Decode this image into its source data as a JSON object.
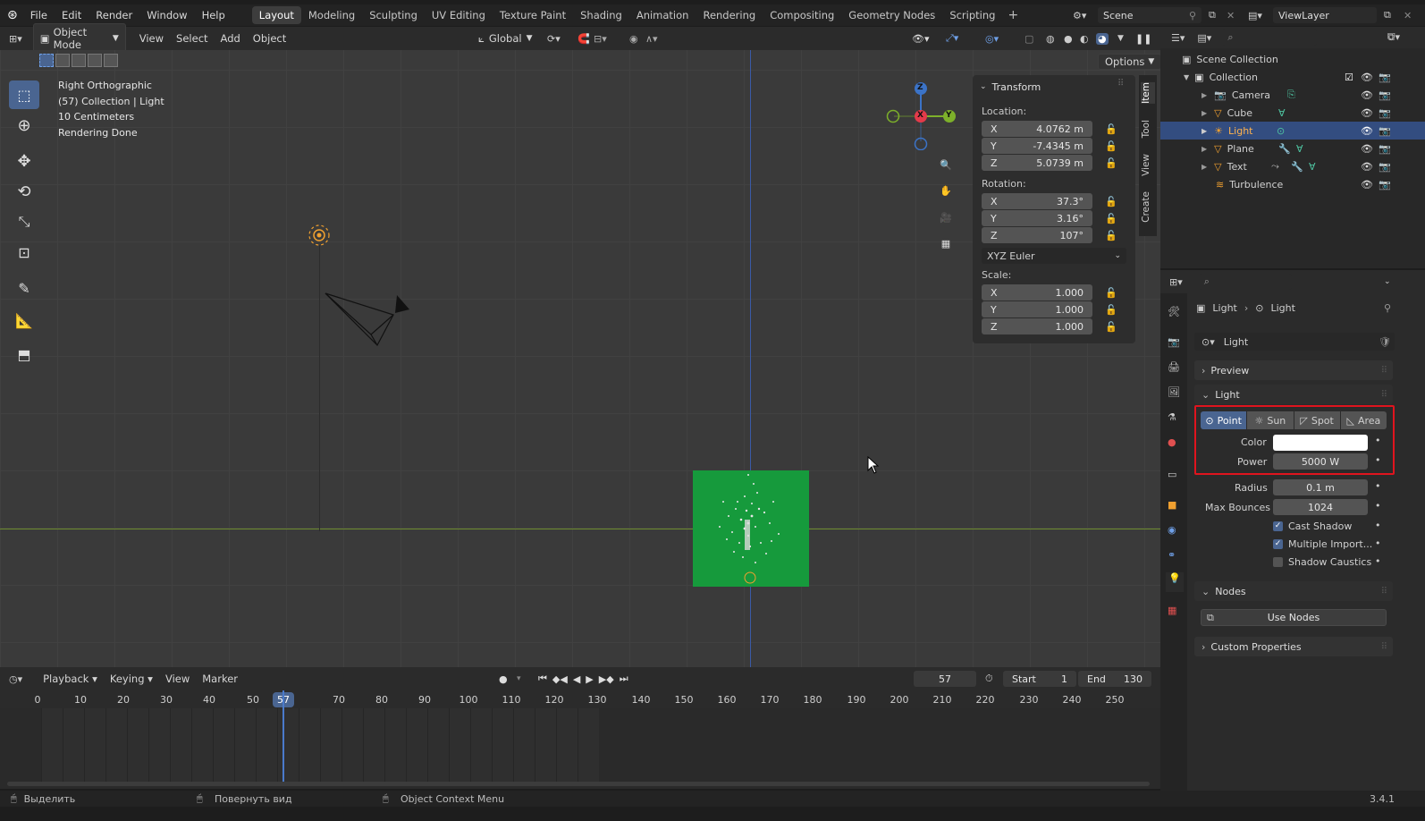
{
  "menu": [
    "File",
    "Edit",
    "Render",
    "Window",
    "Help"
  ],
  "workspaces": [
    "Layout",
    "Modeling",
    "Sculpting",
    "UV Editing",
    "Texture Paint",
    "Shading",
    "Animation",
    "Rendering",
    "Compositing",
    "Geometry Nodes",
    "Scripting"
  ],
  "active_workspace": "Layout",
  "scene": {
    "label": "Scene",
    "view_layer": "ViewLayer"
  },
  "viewport_header": {
    "mode": "Object Mode",
    "items": [
      "View",
      "Select",
      "Add",
      "Object"
    ],
    "orientation": "Global",
    "options": "Options"
  },
  "overlay_text": [
    "Right Orthographic",
    "(57) Collection | Light",
    "10 Centimeters",
    "Rendering Done"
  ],
  "gizmo": {
    "z": "Z",
    "x": "X",
    "y": "Y"
  },
  "transform": {
    "title": "Transform",
    "location_label": "Location:",
    "location": [
      {
        "axis": "X",
        "value": "4.0762 m"
      },
      {
        "axis": "Y",
        "value": "-7.4345 m"
      },
      {
        "axis": "Z",
        "value": "5.0739 m"
      }
    ],
    "rotation_label": "Rotation:",
    "rotation": [
      {
        "axis": "X",
        "value": "37.3°"
      },
      {
        "axis": "Y",
        "value": "3.16°"
      },
      {
        "axis": "Z",
        "value": "107°"
      }
    ],
    "rotation_mode": "XYZ Euler",
    "scale_label": "Scale:",
    "scale": [
      {
        "axis": "X",
        "value": "1.000"
      },
      {
        "axis": "Y",
        "value": "1.000"
      },
      {
        "axis": "Z",
        "value": "1.000"
      }
    ]
  },
  "side_tabs": [
    "Item",
    "Tool",
    "View",
    "Create"
  ],
  "outliner": {
    "scene_collection": "Scene Collection",
    "collection": "Collection",
    "items": [
      {
        "name": "Camera",
        "selected": false
      },
      {
        "name": "Cube",
        "selected": false
      },
      {
        "name": "Light",
        "selected": true
      },
      {
        "name": "Plane",
        "selected": false
      },
      {
        "name": "Text",
        "selected": false
      },
      {
        "name": "Turbulence",
        "selected": false
      }
    ]
  },
  "properties": {
    "breadcrumb": [
      "Light",
      "Light"
    ],
    "datablock": "Light",
    "panels": {
      "preview": "Preview",
      "light": "Light",
      "nodes": "Nodes",
      "custom": "Custom Properties"
    },
    "light_types": [
      "Point",
      "Sun",
      "Spot",
      "Area"
    ],
    "active_light_type": "Point",
    "color_label": "Color",
    "power_label": "Power",
    "power": "5000 W",
    "radius_label": "Radius",
    "radius": "0.1 m",
    "max_bounces_label": "Max Bounces",
    "max_bounces": "1024",
    "cast_shadow": "Cast Shadow",
    "multiple_importance": "Multiple Import...",
    "shadow_caustics": "Shadow Caustics",
    "use_nodes": "Use Nodes"
  },
  "timeline": {
    "menus": [
      "Playback",
      "Keying",
      "View",
      "Marker"
    ],
    "current_frame": "57",
    "start_label": "Start",
    "start": "1",
    "end_label": "End",
    "end": "130",
    "ticks": [
      "0",
      "10",
      "20",
      "30",
      "40",
      "50",
      "70",
      "80",
      "90",
      "100",
      "110",
      "120",
      "130",
      "140",
      "150",
      "160",
      "170",
      "180",
      "190",
      "200",
      "210",
      "220",
      "230",
      "240",
      "250"
    ]
  },
  "statusbar": {
    "select": "Выделить",
    "rotate": "Повернуть вид",
    "context": "Object Context Menu",
    "version": "3.4.1"
  },
  "colors": {
    "accent": "#4a6591",
    "highlight_box": "#e0141e",
    "plane_green": "#169a3c"
  }
}
